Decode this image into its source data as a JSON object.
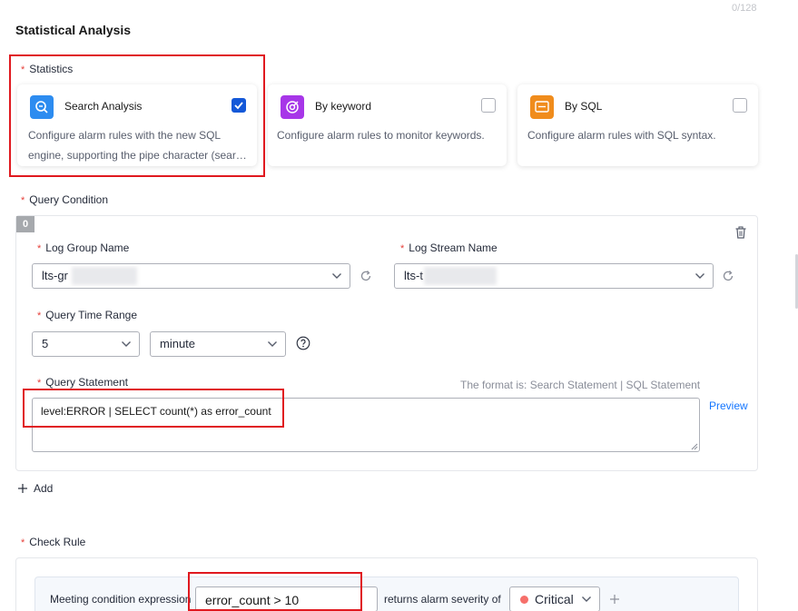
{
  "top_counter": "0/128",
  "section_title": "Statistical Analysis",
  "statistics": {
    "label": "Statistics",
    "options": [
      {
        "name": "Search Analysis",
        "desc": "Configure alarm rules with the new SQL engine, supporting the pipe character (sear…",
        "checked": true,
        "color": "#2d8cf0"
      },
      {
        "name": "By keyword",
        "desc": "Configure alarm rules to monitor keywords.",
        "checked": false,
        "color": "#a736e8"
      },
      {
        "name": "By SQL",
        "desc": "Configure alarm rules with SQL syntax.",
        "checked": false,
        "color": "#f08c1c"
      }
    ]
  },
  "query_condition": {
    "label": "Query Condition",
    "tag": "0",
    "log_group_label": "Log Group Name",
    "log_group_value": "lts-gr",
    "log_stream_label": "Log Stream Name",
    "log_stream_value": "lts-t",
    "time_range_label": "Query Time Range",
    "time_value": "5",
    "time_unit": "minute",
    "statement_label": "Query Statement",
    "format_hint": "The format is: Search Statement | SQL Statement",
    "statement_value": "level:ERROR | SELECT count(*) as error_count",
    "preview": "Preview"
  },
  "add_label": "Add",
  "check_rule": {
    "label": "Check Rule",
    "meeting_label": "Meeting condition expression",
    "expression_value": "error_count > 10",
    "returns_label": "returns alarm severity of",
    "severity": "Critical",
    "severity_color": "#f66f6a"
  }
}
